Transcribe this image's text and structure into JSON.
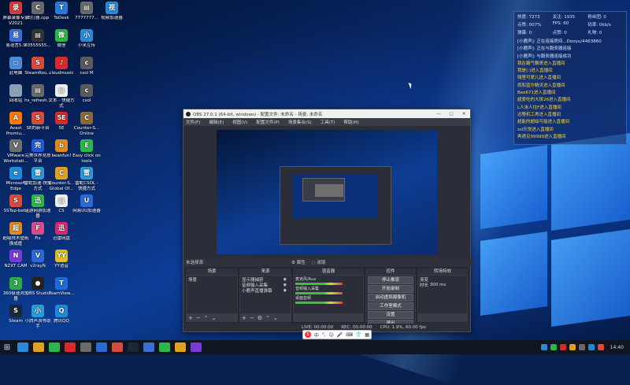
{
  "desktop_icons_col1": [
    {
      "label": "屏幕录像专家 V2021",
      "color": "#d73a3a",
      "glyph": "录"
    },
    {
      "label": "易语言5.9",
      "color": "#3a6ed7",
      "glyph": "易"
    },
    {
      "label": "此电脑",
      "color": "#4a8ad8",
      "glyph": "▭"
    },
    {
      "label": "回收站",
      "color": "#8aa0b8",
      "glyph": "♲"
    },
    {
      "label": "Avast Premiu...",
      "color": "#ff7a00",
      "glyph": "A"
    },
    {
      "label": "VMware Workstati...",
      "color": "#6e6e6e",
      "glyph": "V"
    },
    {
      "label": "Microsoft Edge",
      "color": "#1f8ad8",
      "glyph": "e"
    },
    {
      "label": "SSTap-beta",
      "color": "#d84a3a",
      "glyph": "S"
    },
    {
      "label": "超级技术壁纸 换成框",
      "color": "#e08a20",
      "glyph": "超"
    },
    {
      "label": "NZXT CAM",
      "color": "#7a3ad8",
      "glyph": "N"
    },
    {
      "label": "360极速浏览器",
      "color": "#2ea84a",
      "glyph": "3"
    },
    {
      "label": "Steam",
      "color": "#1b2838",
      "glyph": "S"
    }
  ],
  "desktop_icons_col2": [
    {
      "label": "击打器.cpp",
      "color": "#6a6a6a",
      "glyph": "C"
    },
    {
      "label": "83555555...",
      "color": "#333",
      "glyph": "▤"
    },
    {
      "label": "SteamRou...",
      "color": "#d84a3a",
      "glyph": "S"
    },
    {
      "label": "hs_refresh...",
      "color": "#6a6a6a",
      "glyph": "▤"
    },
    {
      "label": "SE的新平台",
      "color": "#d84a3a",
      "glyph": "S"
    },
    {
      "label": "完美世界竞技平台",
      "color": "#1f5ad8",
      "glyph": "完"
    },
    {
      "label": "雷蛇加速-快捷方式",
      "color": "#2a9ad8",
      "glyph": "雷"
    },
    {
      "label": "迅游网游加速器",
      "color": "#2ab84a",
      "glyph": "迅"
    },
    {
      "label": "Fix",
      "color": "#d84a8a",
      "glyph": "F"
    },
    {
      "label": "v2rayN",
      "color": "#2a6ad8",
      "glyph": "V"
    },
    {
      "label": "OBS Studio",
      "color": "#222",
      "glyph": "●"
    },
    {
      "label": "小牌声浪等助手",
      "color": "#2a9ad8",
      "glyph": "小"
    }
  ],
  "desktop_icons_col3": [
    {
      "label": "ToDesk",
      "color": "#2a7ad8",
      "glyph": "T"
    },
    {
      "label": "微信",
      "color": "#2ab84a",
      "glyph": "微"
    },
    {
      "label": "cloudmusic",
      "color": "#d82a2a",
      "glyph": "♪"
    },
    {
      "label": "文本 - 快捷方式",
      "color": "#eeeeee",
      "glyph": "▤"
    },
    {
      "label": "5E",
      "color": "#d82a2a",
      "glyph": "5E"
    },
    {
      "label": "beanfun!",
      "color": "#e08a20",
      "glyph": "b"
    },
    {
      "label": "Counter-S... Global Of...",
      "color": "#e0a020",
      "glyph": "C"
    },
    {
      "label": "CS",
      "color": "#eeeeee",
      "glyph": "▤"
    },
    {
      "label": "迅雷网盘",
      "color": "#d82a6a",
      "glyph": "迅"
    },
    {
      "label": "YY语音",
      "color": "#e0c020",
      "glyph": "YY"
    },
    {
      "label": "TeamView...",
      "color": "#1f6ad8",
      "glyph": "T"
    },
    {
      "label": "腾讯QQ",
      "color": "#1f8ad8",
      "glyph": "Q"
    }
  ],
  "desktop_icons_col4": [
    {
      "label": "7777777...",
      "color": "#6a6a6a",
      "glyph": "▤"
    },
    {
      "label": "小米互传",
      "color": "#2a8ad8",
      "glyph": "小"
    },
    {
      "label": "csol M",
      "color": "#5a5a5a",
      "glyph": "c"
    },
    {
      "label": "csol",
      "color": "#5a5a5a",
      "glyph": "c"
    },
    {
      "label": "Counter-S... Online",
      "color": "#8a6a3a",
      "glyph": "C"
    },
    {
      "label": "Easy click on tools",
      "color": "#2ab84a",
      "glyph": "E"
    },
    {
      "label": "雷蛇CSOL - 快捷方式",
      "color": "#2a9ad8",
      "glyph": "雷"
    },
    {
      "label": "网易UU加速器",
      "color": "#2a6ad8",
      "glyph": "U"
    }
  ],
  "desktop_icons_col5": [
    {
      "label": "视频加速器",
      "color": "#2a8ad8",
      "glyph": "视"
    }
  ],
  "stats": {
    "row1": [
      "热度: 7273",
      "关注: 1935",
      "粉丝团: 0"
    ],
    "row2": [
      "点赞: 007%",
      "FPS: 60",
      "码率: 0kb/s"
    ],
    "row3": [
      "弹幕: 0",
      "点赞: 0",
      "礼物: 0"
    ],
    "log": [
      {
        "type": "sys",
        "text": "[小鹿声]: 正在连接房间...Dooyu/4463860"
      },
      {
        "type": "sys",
        "text": "[小鹿声]: 正在与服务器连接"
      },
      {
        "type": "sys",
        "text": "[小鹿声]: 与服务器连接成功"
      },
      {
        "type": "usr",
        "text": "我在霸气飘哥进入直播间"
      },
      {
        "type": "usr",
        "text": "我是(:)进入直播间"
      },
      {
        "type": "usr",
        "text": "嗨里可爱儿进入直播间"
      },
      {
        "type": "usr",
        "text": "雨和蓝尔精灵进入直播间"
      },
      {
        "type": "usr",
        "text": "Bee671进入直播间"
      },
      {
        "type": "usr",
        "text": "超爱吃的大饼26进入直播间"
      },
      {
        "type": "usr",
        "text": "L人米人往F进入直播间"
      },
      {
        "type": "usr",
        "text": "迅警机工男进入直播间"
      },
      {
        "type": "usr",
        "text": "超能的超级可能进入直播间"
      },
      {
        "type": "usr",
        "text": "ssl乐悦进入直播间"
      },
      {
        "type": "usr",
        "text": "再遇见99999进入直播间"
      }
    ]
  },
  "obs": {
    "title": "OBS 27.0.1 (64-bit, windows) - 配置文件: 未命名 - 场景: 未命名",
    "menu": [
      "文件(F)",
      "编辑(E)",
      "视图(V)",
      "配置文件(P)",
      "场景集合(S)",
      "工具(T)",
      "帮助(H)"
    ],
    "scene_bar_left": "未选择源",
    "scene_bar_mid": [
      "⚙ 属性",
      "◌ 滤镜"
    ],
    "docks": {
      "scenes": {
        "title": "场景",
        "items": [
          "场景"
        ]
      },
      "sources": {
        "title": "来源",
        "items": [
          "显示器捕获",
          "音频输入采集",
          "小鹿声直播弹幕"
        ]
      },
      "mixer": {
        "title": "混音器",
        "rows": [
          "麦克风/Aux",
          "音频输入采集",
          "桌面音频"
        ]
      },
      "transitions": {
        "title": "转场特效",
        "label1": "渐变",
        "label2": "时长",
        "value2": "300 ms"
      },
      "controls": {
        "title": "控件",
        "buttons": [
          "停止推流",
          "开始录制",
          "启动虚拟摄像机",
          "工作室模式",
          "设置",
          "退出"
        ]
      }
    },
    "status": [
      "LIVE: 00:00:00",
      "REC: 00:00:00",
      "CPU: 1.9%, 60.00 fps"
    ]
  },
  "ime": [
    "S",
    "中",
    "°,",
    "☺",
    "🎤",
    "⌨",
    "👕",
    "▦"
  ],
  "taskbar": {
    "time": "14:40",
    "icons_colors": [
      "#2a8ad8",
      "#e0a020",
      "#2ab84a",
      "#d82a2a",
      "#6a6a6a",
      "#2a6ad8",
      "#d84a3a",
      "#1b2838",
      "#3a6ed7",
      "#2ab84a",
      "#e0a020",
      "#7a3ad8"
    ],
    "tray_colors": [
      "#2a8ad8",
      "#2ab84a",
      "#d82a2a",
      "#e0a020",
      "#6a6a6a",
      "#1f8ad8",
      "#d84a3a"
    ]
  }
}
